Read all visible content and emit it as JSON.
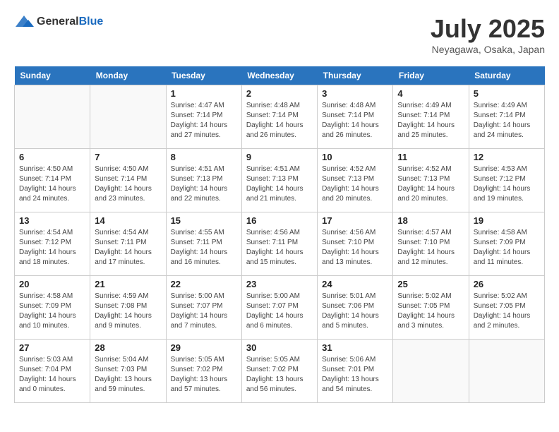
{
  "logo": {
    "general": "General",
    "blue": "Blue"
  },
  "title": {
    "month_year": "July 2025",
    "location": "Neyagawa, Osaka, Japan"
  },
  "calendar": {
    "headers": [
      "Sunday",
      "Monday",
      "Tuesday",
      "Wednesday",
      "Thursday",
      "Friday",
      "Saturday"
    ],
    "rows": [
      [
        {
          "day": "",
          "info": ""
        },
        {
          "day": "",
          "info": ""
        },
        {
          "day": "1",
          "info": "Sunrise: 4:47 AM\nSunset: 7:14 PM\nDaylight: 14 hours and 27 minutes."
        },
        {
          "day": "2",
          "info": "Sunrise: 4:48 AM\nSunset: 7:14 PM\nDaylight: 14 hours and 26 minutes."
        },
        {
          "day": "3",
          "info": "Sunrise: 4:48 AM\nSunset: 7:14 PM\nDaylight: 14 hours and 26 minutes."
        },
        {
          "day": "4",
          "info": "Sunrise: 4:49 AM\nSunset: 7:14 PM\nDaylight: 14 hours and 25 minutes."
        },
        {
          "day": "5",
          "info": "Sunrise: 4:49 AM\nSunset: 7:14 PM\nDaylight: 14 hours and 24 minutes."
        }
      ],
      [
        {
          "day": "6",
          "info": "Sunrise: 4:50 AM\nSunset: 7:14 PM\nDaylight: 14 hours and 24 minutes."
        },
        {
          "day": "7",
          "info": "Sunrise: 4:50 AM\nSunset: 7:14 PM\nDaylight: 14 hours and 23 minutes."
        },
        {
          "day": "8",
          "info": "Sunrise: 4:51 AM\nSunset: 7:13 PM\nDaylight: 14 hours and 22 minutes."
        },
        {
          "day": "9",
          "info": "Sunrise: 4:51 AM\nSunset: 7:13 PM\nDaylight: 14 hours and 21 minutes."
        },
        {
          "day": "10",
          "info": "Sunrise: 4:52 AM\nSunset: 7:13 PM\nDaylight: 14 hours and 20 minutes."
        },
        {
          "day": "11",
          "info": "Sunrise: 4:52 AM\nSunset: 7:13 PM\nDaylight: 14 hours and 20 minutes."
        },
        {
          "day": "12",
          "info": "Sunrise: 4:53 AM\nSunset: 7:12 PM\nDaylight: 14 hours and 19 minutes."
        }
      ],
      [
        {
          "day": "13",
          "info": "Sunrise: 4:54 AM\nSunset: 7:12 PM\nDaylight: 14 hours and 18 minutes."
        },
        {
          "day": "14",
          "info": "Sunrise: 4:54 AM\nSunset: 7:11 PM\nDaylight: 14 hours and 17 minutes."
        },
        {
          "day": "15",
          "info": "Sunrise: 4:55 AM\nSunset: 7:11 PM\nDaylight: 14 hours and 16 minutes."
        },
        {
          "day": "16",
          "info": "Sunrise: 4:56 AM\nSunset: 7:11 PM\nDaylight: 14 hours and 15 minutes."
        },
        {
          "day": "17",
          "info": "Sunrise: 4:56 AM\nSunset: 7:10 PM\nDaylight: 14 hours and 13 minutes."
        },
        {
          "day": "18",
          "info": "Sunrise: 4:57 AM\nSunset: 7:10 PM\nDaylight: 14 hours and 12 minutes."
        },
        {
          "day": "19",
          "info": "Sunrise: 4:58 AM\nSunset: 7:09 PM\nDaylight: 14 hours and 11 minutes."
        }
      ],
      [
        {
          "day": "20",
          "info": "Sunrise: 4:58 AM\nSunset: 7:09 PM\nDaylight: 14 hours and 10 minutes."
        },
        {
          "day": "21",
          "info": "Sunrise: 4:59 AM\nSunset: 7:08 PM\nDaylight: 14 hours and 9 minutes."
        },
        {
          "day": "22",
          "info": "Sunrise: 5:00 AM\nSunset: 7:07 PM\nDaylight: 14 hours and 7 minutes."
        },
        {
          "day": "23",
          "info": "Sunrise: 5:00 AM\nSunset: 7:07 PM\nDaylight: 14 hours and 6 minutes."
        },
        {
          "day": "24",
          "info": "Sunrise: 5:01 AM\nSunset: 7:06 PM\nDaylight: 14 hours and 5 minutes."
        },
        {
          "day": "25",
          "info": "Sunrise: 5:02 AM\nSunset: 7:05 PM\nDaylight: 14 hours and 3 minutes."
        },
        {
          "day": "26",
          "info": "Sunrise: 5:02 AM\nSunset: 7:05 PM\nDaylight: 14 hours and 2 minutes."
        }
      ],
      [
        {
          "day": "27",
          "info": "Sunrise: 5:03 AM\nSunset: 7:04 PM\nDaylight: 14 hours and 0 minutes."
        },
        {
          "day": "28",
          "info": "Sunrise: 5:04 AM\nSunset: 7:03 PM\nDaylight: 13 hours and 59 minutes."
        },
        {
          "day": "29",
          "info": "Sunrise: 5:05 AM\nSunset: 7:02 PM\nDaylight: 13 hours and 57 minutes."
        },
        {
          "day": "30",
          "info": "Sunrise: 5:05 AM\nSunset: 7:02 PM\nDaylight: 13 hours and 56 minutes."
        },
        {
          "day": "31",
          "info": "Sunrise: 5:06 AM\nSunset: 7:01 PM\nDaylight: 13 hours and 54 minutes."
        },
        {
          "day": "",
          "info": ""
        },
        {
          "day": "",
          "info": ""
        }
      ]
    ]
  }
}
